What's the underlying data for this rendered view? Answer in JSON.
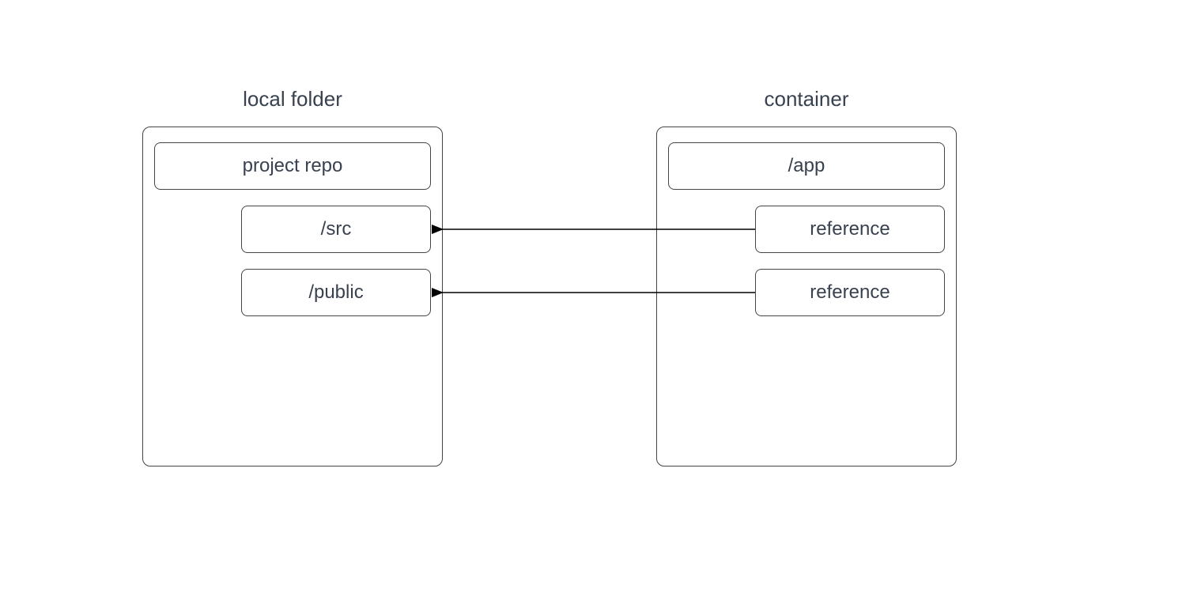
{
  "left": {
    "title": "local folder",
    "top_box": "project repo",
    "child1": "/src",
    "child2": "/public"
  },
  "right": {
    "title": "container",
    "top_box": "/app",
    "child1": "reference",
    "child2": "reference"
  }
}
